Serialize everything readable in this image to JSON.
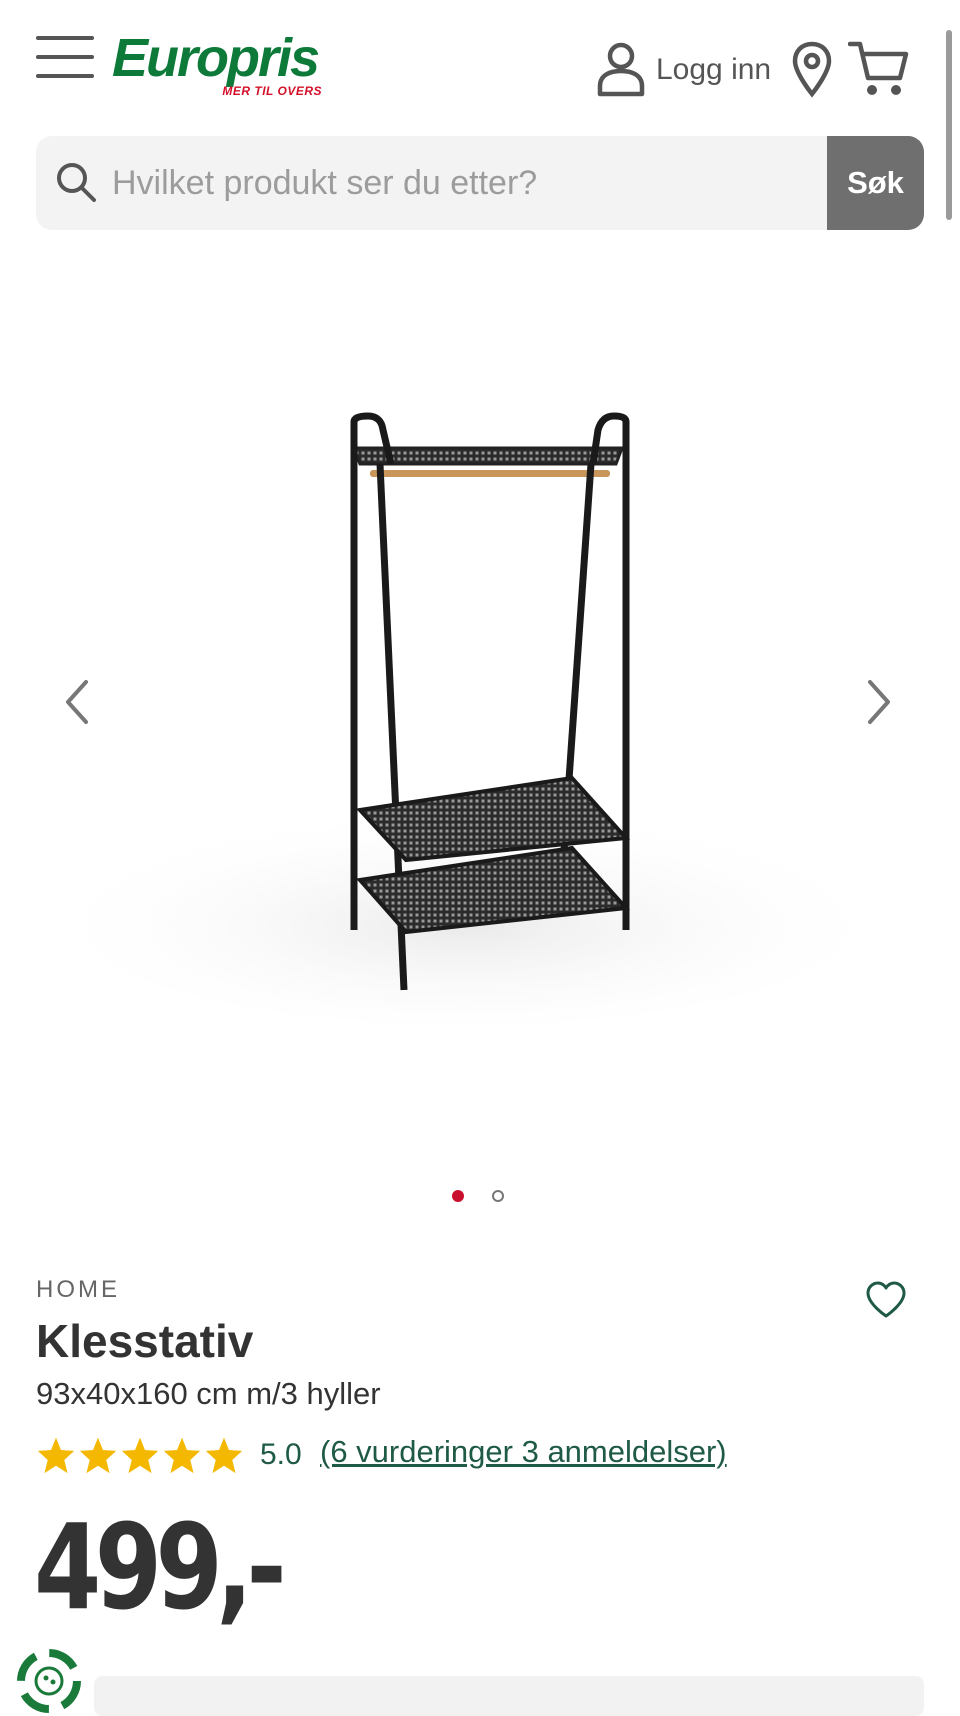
{
  "header": {
    "logo_text": "Europris",
    "logo_tagline": "MER TIL OVERS",
    "login_label": "Logg inn",
    "brand_colors": {
      "green": "#0e7a3a",
      "red": "#d4102a"
    },
    "icons": [
      "hamburger-menu-icon",
      "user-icon",
      "location-pin-icon",
      "cart-icon"
    ]
  },
  "search": {
    "placeholder": "Hvilket produkt ser du etter?",
    "button_label": "Søk"
  },
  "gallery": {
    "image_count": 2,
    "active_index": 0,
    "active_dot_color": "#c8102e",
    "icons": [
      "chevron-left-icon",
      "chevron-right-icon"
    ]
  },
  "product": {
    "brand": "HOME",
    "title": "Klesstativ",
    "subtitle": "93x40x160 cm m/3 hyller",
    "rating_value": "5.0",
    "rating_stars": 5,
    "reviews_link": "(6 vurderinger 3 anmeldelser)",
    "price": "499,-",
    "accent_color": "#1f5a44",
    "star_color": "#f5b800"
  }
}
